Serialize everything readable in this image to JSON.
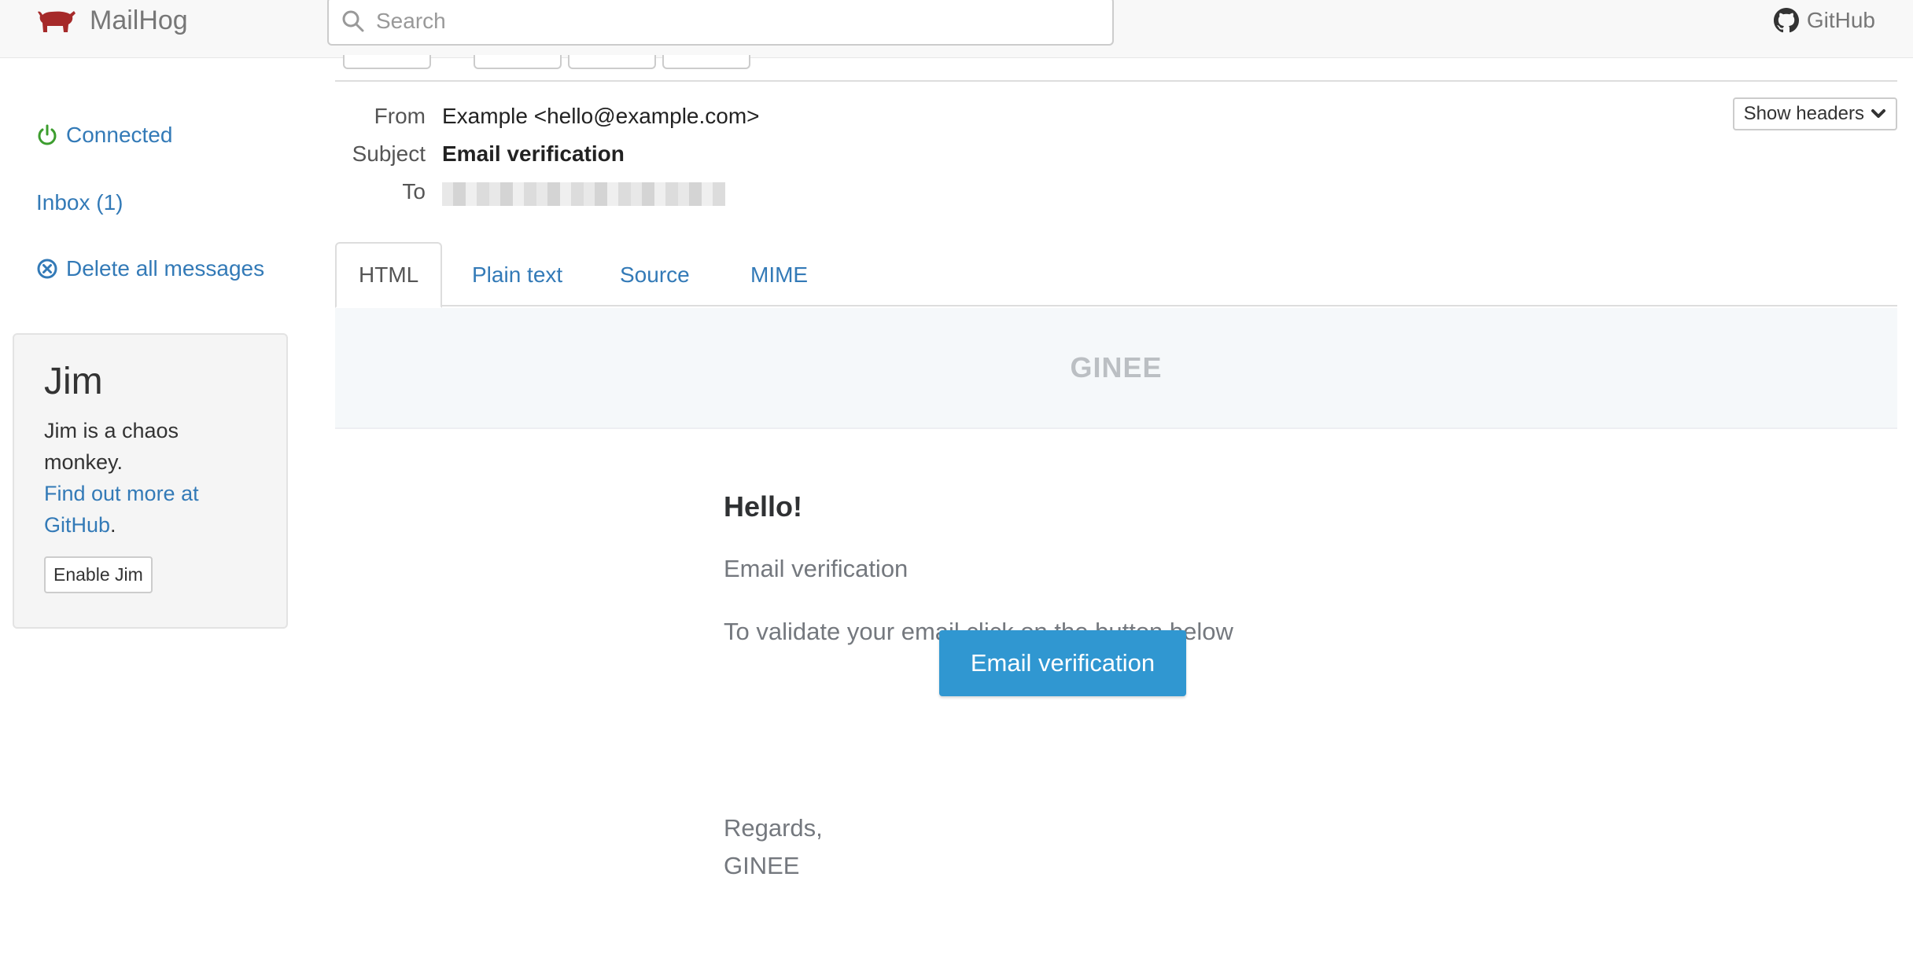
{
  "navbar": {
    "brand": "MailHog",
    "search_placeholder": "Search",
    "github_label": "GitHub"
  },
  "sidebar": {
    "connected": "Connected",
    "inbox": "Inbox (1)",
    "delete_all": "Delete all messages"
  },
  "jim": {
    "title": "Jim",
    "description": "Jim is a chaos monkey.",
    "link_text": "Find out more at GitHub",
    "link_suffix": ".",
    "button": "Enable Jim"
  },
  "message": {
    "from_label": "From",
    "from_value": "Example <hello@example.com>",
    "subject_label": "Subject",
    "subject_value": "Email verification",
    "to_label": "To",
    "show_headers": "Show headers"
  },
  "tabs": [
    {
      "label": "HTML",
      "active": true
    },
    {
      "label": "Plain text",
      "active": false
    },
    {
      "label": "Source",
      "active": false
    },
    {
      "label": "MIME",
      "active": false
    }
  ],
  "email": {
    "header_brand": "GINEE",
    "greeting": "Hello!",
    "line1": "Email verification",
    "line2": "To validate your email click on the button below",
    "button": "Email verification",
    "regards": "Regards,",
    "signature": "GINEE"
  },
  "colors": {
    "link": "#337ab7",
    "brand_pig": "#a62a2a",
    "connected": "#3c9d2e",
    "cta": "#3097d1"
  }
}
